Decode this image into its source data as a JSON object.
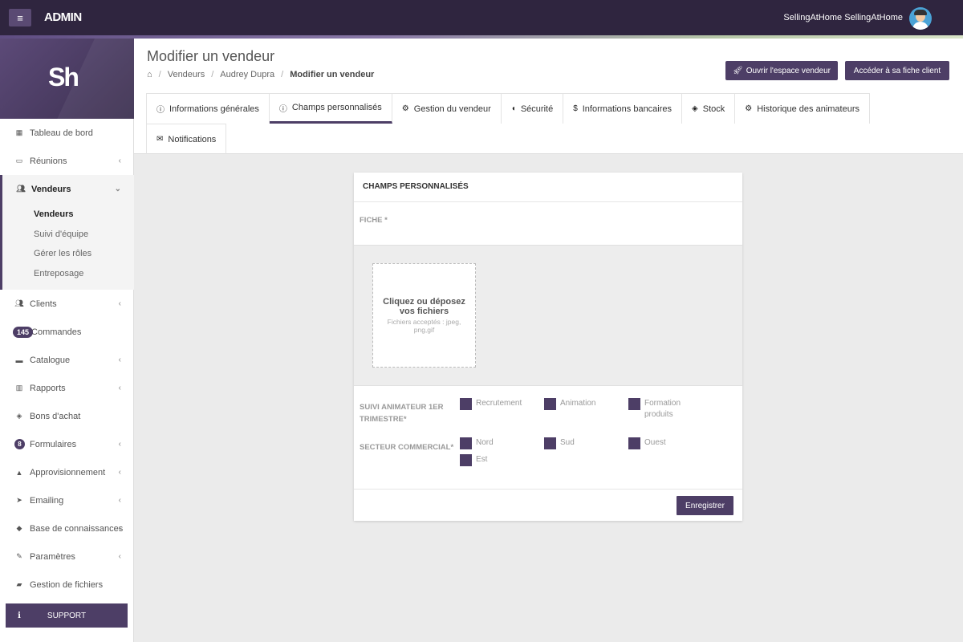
{
  "topbar": {
    "brand": "ADMIN",
    "menu_icon": "hamburger-icon",
    "user_name": "SellingAtHome SellingAtHome",
    "avatar_icon": "user-avatar-icon"
  },
  "sidebar": {
    "logo": "Sh",
    "items": [
      {
        "label": "Tableau de bord",
        "icon": "dashboard-icon"
      },
      {
        "label": "Réunions",
        "icon": "calendar-icon"
      },
      {
        "label": "Vendeurs",
        "icon": "users-icon"
      },
      {
        "label": "Clients",
        "icon": "users-icon"
      },
      {
        "label": "Commandes",
        "badge": "145"
      },
      {
        "label": "Catalogue",
        "icon": "archive-icon"
      },
      {
        "label": "Rapports",
        "icon": "bar-chart-icon"
      },
      {
        "label": "Bons d'achat",
        "icon": "tags-icon"
      },
      {
        "label": "Formulaires",
        "badge": "8"
      },
      {
        "label": "Approvisionnement",
        "icon": "area-chart-icon"
      },
      {
        "label": "Emailing",
        "icon": "paper-plane-icon"
      },
      {
        "label": "Base de connaissances",
        "icon": "graduation-cap-icon"
      },
      {
        "label": "Paramètres",
        "icon": "wrench-icon"
      },
      {
        "label": "Gestion de fichiers",
        "icon": "folder-open-icon"
      }
    ],
    "sub_items": [
      "Vendeurs",
      "Suivi d'équipe",
      "Gérer les rôles",
      "Entreposage"
    ],
    "support": "SUPPORT",
    "support_icon": "i"
  },
  "header": {
    "title": "Modifier un vendeur",
    "breadcrumb": [
      "Vendeurs",
      "Audrey Dupra",
      "Modifier un vendeur"
    ],
    "btn_open": "Ouvrir l'espace vendeur",
    "btn_client": "Accéder à sa fiche client"
  },
  "tabs": [
    {
      "label": "Informations générales",
      "icon": "info-circle-icon"
    },
    {
      "label": "Champs personnalisés",
      "icon": "info-circle-icon"
    },
    {
      "label": "Gestion du vendeur",
      "icon": "gear-icon"
    },
    {
      "label": "Sécurité",
      "icon": "shield-icon"
    },
    {
      "label": "Informations bancaires",
      "icon": "dollar-icon"
    },
    {
      "label": "Stock",
      "icon": "cube-icon"
    },
    {
      "label": "Historique des animateurs",
      "icon": "gear-icon"
    },
    {
      "label": "Notifications",
      "icon": "envelope-icon"
    }
  ],
  "card": {
    "title": "CHAMPS PERSONNALISÉS",
    "fiche_label": "FICHE *",
    "dropzone_title": "Cliquez ou déposez vos fichiers",
    "dropzone_sub": "Fichiers acceptés : jpeg, png,gif",
    "suivi_label": "SUIVI ANIMATEUR 1ER TRIMESTRE*",
    "suivi_options": [
      "Recrutement",
      "Animation",
      "Formation produits"
    ],
    "secteur_label": "SECTEUR COMMERCIAL*",
    "secteur_options": [
      "Nord",
      "Sud",
      "Ouest",
      "Est"
    ],
    "save": "Enregistrer"
  },
  "colors": {
    "primary": "#4d3e66",
    "topbar": "#2f253f"
  }
}
